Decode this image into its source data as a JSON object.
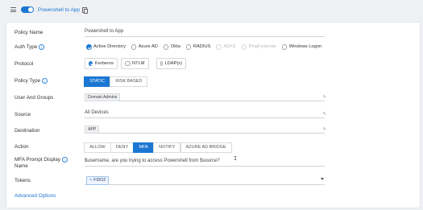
{
  "header": {
    "policy_title": "Powershell to App",
    "enabled": true
  },
  "form": {
    "policy_name": {
      "label": "Policy Name",
      "value": "Powershell to App"
    },
    "auth_type": {
      "label": "Auth Type",
      "options": [
        {
          "label": "Active Directory",
          "selected": true,
          "disabled": false
        },
        {
          "label": "Azure AD",
          "selected": false,
          "disabled": false
        },
        {
          "label": "Okta",
          "selected": false,
          "disabled": false
        },
        {
          "label": "RADIUS",
          "selected": false,
          "disabled": false
        },
        {
          "label": "ADFS",
          "selected": false,
          "disabled": true
        },
        {
          "label": "PingFederate",
          "selected": false,
          "disabled": true
        },
        {
          "label": "Windows Logon",
          "selected": false,
          "disabled": false
        }
      ]
    },
    "protocol": {
      "label": "Protocol",
      "options": [
        {
          "label": "Kerberos",
          "selected": true
        },
        {
          "label": "NTLM",
          "selected": false
        },
        {
          "label": "LDAP(s)",
          "selected": false
        }
      ]
    },
    "policy_type": {
      "label": "Policy Type",
      "options": [
        "STATIC",
        "RISK BASED"
      ],
      "selected": "STATIC"
    },
    "user_groups": {
      "label": "User And Groups",
      "chip": "Domain Admins"
    },
    "source": {
      "label": "Source",
      "value": "All Devices"
    },
    "destination": {
      "label": "Destination",
      "chip": "APP"
    },
    "action": {
      "label": "Action",
      "options": [
        "ALLOW",
        "DENY",
        "MFA",
        "NOTIFY",
        "AZURE AD BRIDGE"
      ],
      "selected": "MFA"
    },
    "mfa_prompt": {
      "label_line1": "MFA Prompt Display",
      "label_line2": "Name",
      "value": "$username, are you trying to access Powershell from $source?"
    },
    "tokens": {
      "label": "Tokens",
      "token": "FIDO2",
      "remove_symbol": "×"
    },
    "advanced": {
      "label": "Advanced Options"
    }
  },
  "icons": {
    "info": "info-icon",
    "edit": "edit-icon",
    "copy": "copy-icon",
    "menu": "hamburger-menu-icon"
  },
  "colors": {
    "accent": "#1b77d2",
    "background": "#eef0f3"
  }
}
